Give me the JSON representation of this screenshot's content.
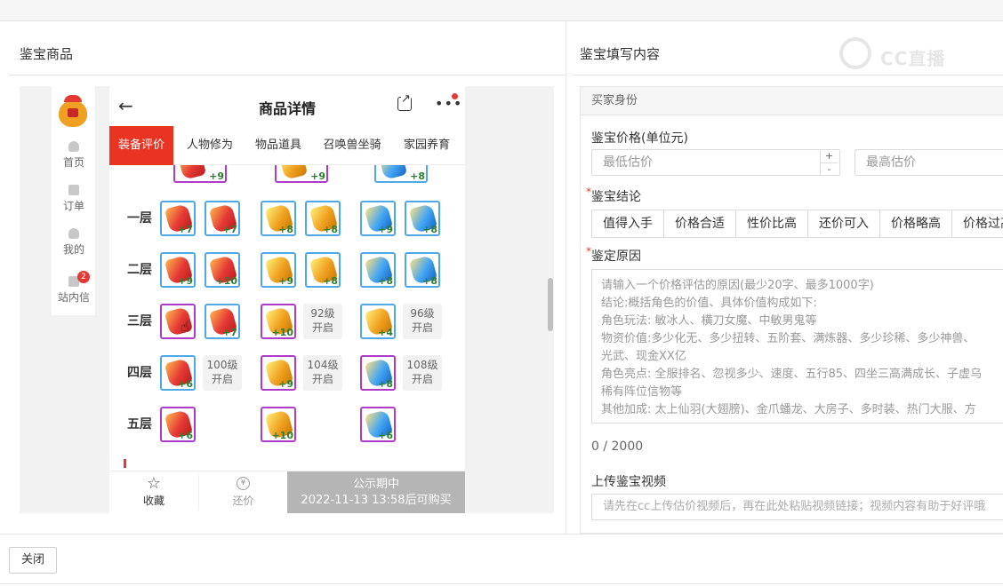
{
  "sections": {
    "left_title": "鉴宝商品",
    "right_title": "鉴宝填写内容",
    "watermark": "CC直播"
  },
  "sidebar": {
    "items": [
      {
        "label": "首页",
        "icon": "home-icon"
      },
      {
        "label": "订单",
        "icon": "order-icon"
      },
      {
        "label": "我的",
        "icon": "user-icon"
      },
      {
        "label": "站内信",
        "icon": "mail-icon",
        "badge": "2"
      }
    ]
  },
  "phone": {
    "back": "←",
    "title": "商品详情",
    "more": "•••",
    "tabs": [
      "装备评价",
      "人物修为",
      "物品道具",
      "召唤兽坐骑",
      "家园养育"
    ],
    "active_tab": "装备评价",
    "top_levels": [
      "+9",
      "+9",
      "+8"
    ],
    "rows": [
      {
        "label": "一层",
        "levels": [
          "+7",
          "+7",
          "+8",
          "+8",
          "+9",
          "+8"
        ]
      },
      {
        "label": "二层",
        "levels": [
          "+9",
          "+10",
          "+9",
          "+8",
          "+8",
          "+8"
        ]
      },
      {
        "label": "三层",
        "levels": [
          "",
          "+7",
          "+10",
          "",
          "+4",
          ""
        ],
        "locked": [
          "92级",
          "开启",
          "96级",
          "开启"
        ]
      },
      {
        "label": "四层",
        "levels": [
          "+6",
          "",
          "+9",
          "",
          "+8",
          ""
        ],
        "locked": [
          "100级",
          "开启",
          "104级",
          "开启",
          "108级",
          "开启"
        ]
      },
      {
        "label": "五层",
        "levels": [
          "+6",
          "+10",
          "+6"
        ]
      }
    ],
    "bottom": {
      "favorite": "收藏",
      "bargain": "还价",
      "coin_symbol": "¥",
      "buy_line1": "公示期中",
      "buy_line2": "2022-11-13 13:58后可购买"
    }
  },
  "form": {
    "header": "买家身份",
    "price_label": "鉴宝价格(单位元)",
    "min_price_placeholder": "最低估价",
    "max_price_placeholder": "最高估价",
    "stepper_plus": "+",
    "stepper_minus": "-",
    "conclusion_label": "鉴宝结论",
    "conclusion_options": [
      "值得入手",
      "价格合适",
      "性价比高",
      "还价可入",
      "价格略高",
      "价格过高"
    ],
    "reason_label": "鉴定原因",
    "reason_lines": [
      "请输入一个价格评估的原因(最少20字、最多1000字)",
      "  结论:概括角色的价值、具体价值构成如下:",
      "  角色玩法: 敏冰人、横刀女魔、中敏男鬼等",
      "  物资价值:多少化无、多少扭转、五阶套、满炼器、多少珍稀、多少神兽、",
      "光武、现金XX亿",
      "  角色亮点: 全服排名、忽视多少、速度、五行85、四坐三高满成长、子虚乌",
      "稀有阵位信物等",
      "  其他加成: 太上仙羽(大翅膀)、金爪蟠龙、大房子、多时装、热门大服、方"
    ],
    "counter": "0 / 2000",
    "upload_label": "上传鉴宝视频",
    "upload_placeholder": "请先在cc上传估价视频后，再在此处粘贴视频链接；视频内容有助于好评哦"
  },
  "footer": {
    "close": "关闭"
  },
  "colors": {
    "accent": "#e93323",
    "border_blue": "#4ea8e6",
    "border_purple": "#b03ac8",
    "level_green": "#2e7d32",
    "disabled_gray": "#b5b5b5"
  }
}
